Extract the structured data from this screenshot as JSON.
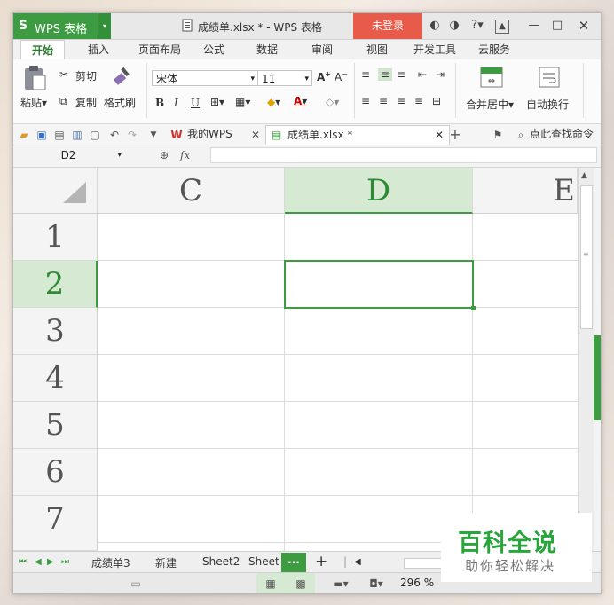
{
  "titlebar": {
    "app_name": "WPS 表格",
    "doc_title": "成绩单.xlsx * - WPS 表格",
    "login_label": "未登录",
    "help_label": "?"
  },
  "menu_tabs": [
    "开始",
    "插入",
    "页面布局",
    "公式",
    "数据",
    "审阅",
    "视图",
    "开发工具",
    "云服务"
  ],
  "ribbon": {
    "paste": "粘贴",
    "cut": "剪切",
    "copy": "复制",
    "format_painter": "格式刷",
    "font_name": "宋体",
    "font_size": "11",
    "bold": "B",
    "italic": "I",
    "underline": "U",
    "merge_center": "合并居中",
    "auto_wrap": "自动换行"
  },
  "quickbar": {
    "tab_mywps": "我的WPS",
    "tab_doc": "成绩单.xlsx *",
    "search_cmd": "点此查找命令"
  },
  "formula": {
    "name_box": "D2",
    "fx": "fx",
    "value": ""
  },
  "grid": {
    "columns": [
      "C",
      "D",
      "E"
    ],
    "rows": [
      "1",
      "2",
      "3",
      "4",
      "5",
      "6",
      "7"
    ],
    "selected_cell": "D2"
  },
  "sheets": {
    "tabs": [
      "成绩单3",
      "新建",
      "Sheet2",
      "Sheet"
    ],
    "more": "···",
    "add": "+"
  },
  "status": {
    "zoom": "296 %"
  },
  "watermark": {
    "title": "百科全说",
    "subtitle": "助你轻松解决"
  },
  "colors": {
    "accent_green": "#3d9b41",
    "login_red": "#e85b4a",
    "selection_fill": "#d6e9d3"
  }
}
